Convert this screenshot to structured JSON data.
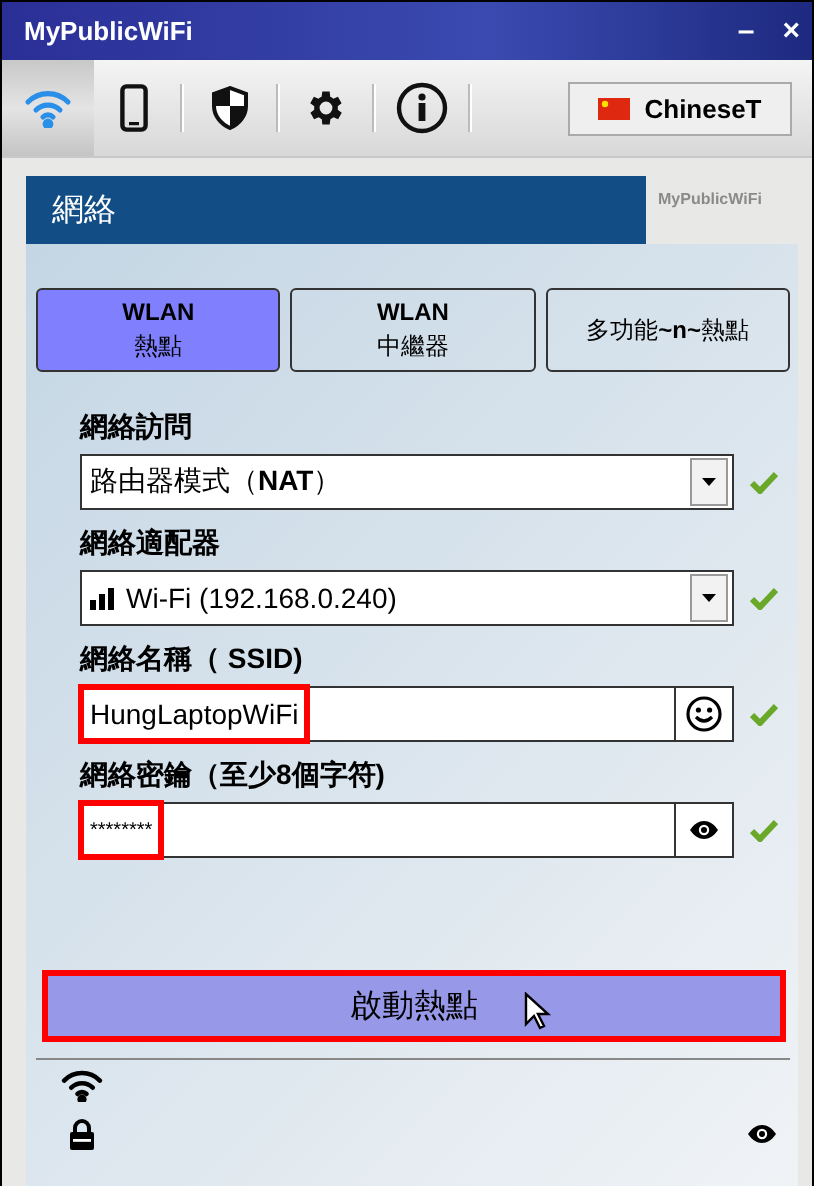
{
  "window": {
    "title": "MyPublicWiFi",
    "minimize": "–",
    "close": "×"
  },
  "toolbar": [
    {
      "kind": "wifi",
      "selected": true
    },
    {
      "kind": "phone",
      "selected": false
    },
    {
      "kind": "shield",
      "selected": false
    },
    {
      "kind": "gear",
      "selected": false
    },
    {
      "kind": "info",
      "selected": false
    }
  ],
  "language": {
    "label": "ChineseT"
  },
  "panel": {
    "title": "網絡",
    "brand": "MyPublicWiFi"
  },
  "modes": [
    {
      "title": "WLAN",
      "subtitle": "熱點",
      "selected": true
    },
    {
      "title": "WLAN",
      "subtitle": "中繼器",
      "selected": false
    },
    {
      "title": "多功能**~n~**熱點",
      "selected": false
    }
  ],
  "fields": [
    {
      "kind": "select",
      "label": "網絡訪問",
      "value": "路由器模式（**NAT**）",
      "valid": true,
      "highlighted": false
    },
    {
      "kind": "adapter",
      "label": "網絡適配器",
      "value": "Wi-Fi (192.168.0.240)",
      "valid": true,
      "highlighted": false
    },
    {
      "kind": "ssid",
      "label": "網絡名稱（ SSID)",
      "value": "HungLaptopWiFi",
      "valid": true,
      "highlighted": true
    },
    {
      "kind": "password",
      "label": "網絡密鑰（至少8個字符)",
      "value": "********",
      "valid": true,
      "highlighted": true
    }
  ],
  "start_button": {
    "label": "啟動熱點",
    "highlighted": true
  },
  "status": [
    {
      "kind": "wifi"
    },
    {
      "kind": "lock"
    }
  ]
}
